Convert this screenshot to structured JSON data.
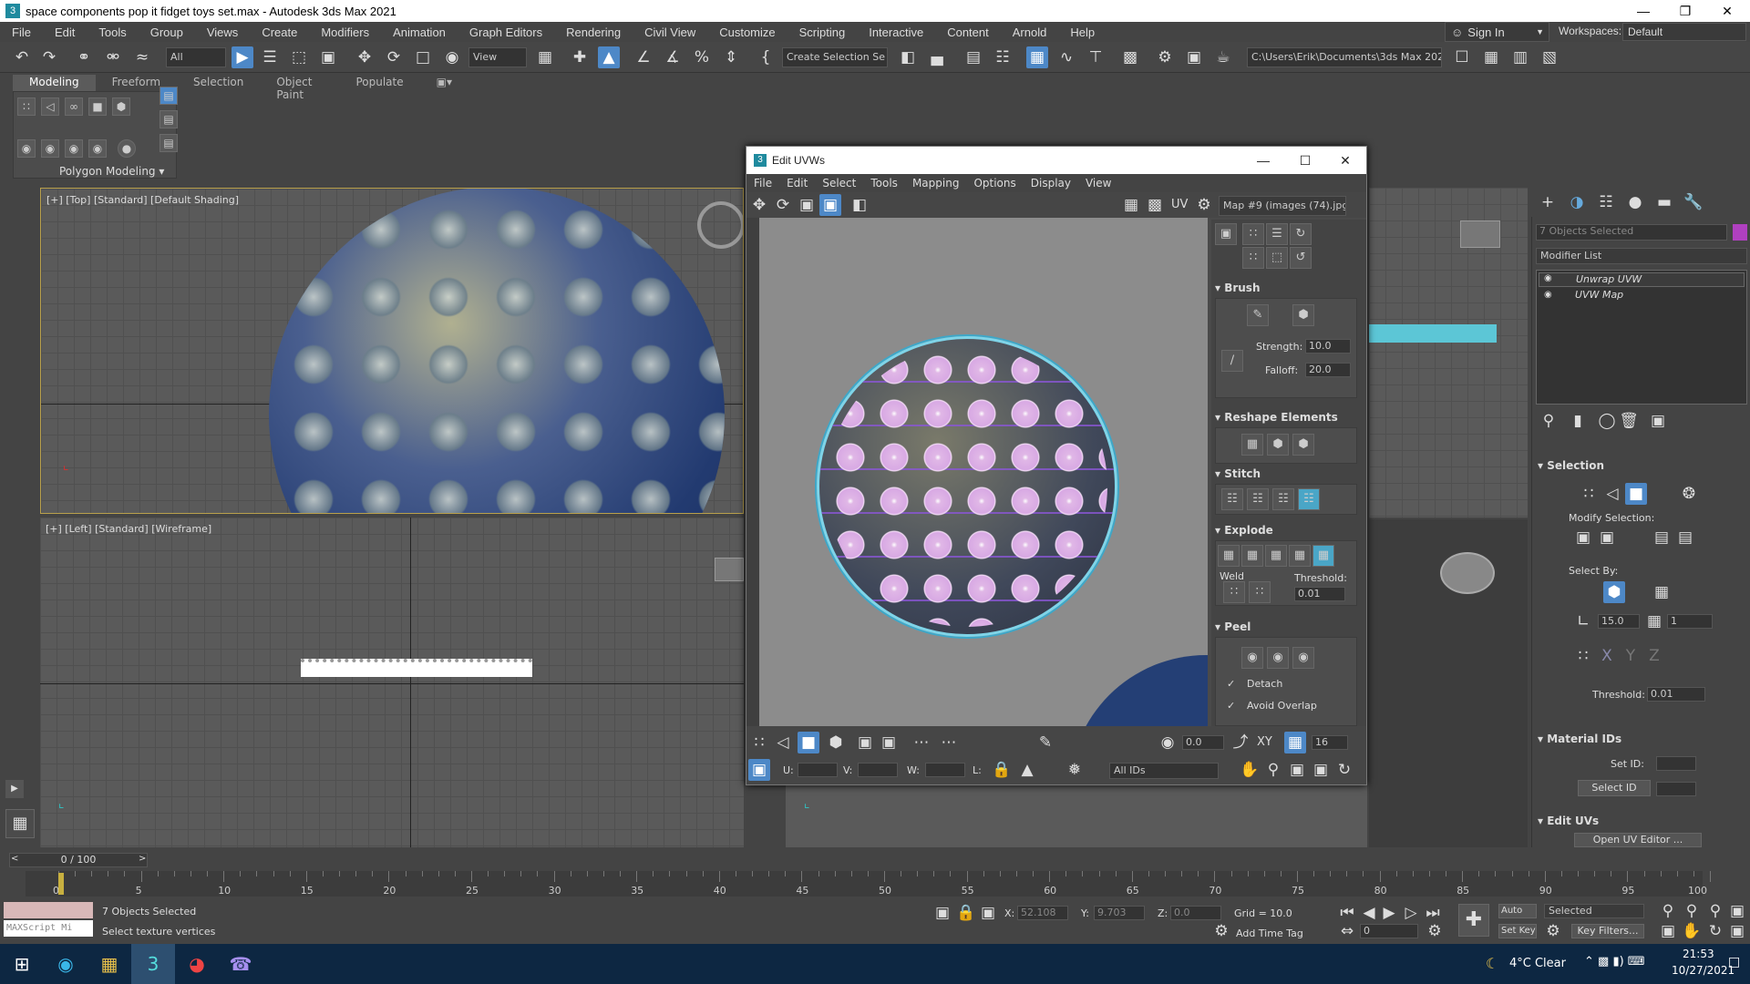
{
  "window": {
    "title": "space components pop it fidget toys set.max - Autodesk 3ds Max 2021"
  },
  "menu": [
    "File",
    "Edit",
    "Tools",
    "Group",
    "Views",
    "Create",
    "Modifiers",
    "Animation",
    "Graph Editors",
    "Rendering",
    "Civil View",
    "Customize",
    "Scripting",
    "Interactive",
    "Content",
    "Arnold",
    "Help"
  ],
  "account": {
    "sign_in": "Sign In",
    "workspaces_label": "Workspaces:",
    "workspace": "Default"
  },
  "toolbar": {
    "filter": "All",
    "view": "View",
    "selection_set": "Create Selection Se",
    "project_path": "C:\\Users\\Erik\\Documents\\3ds Max 2021"
  },
  "ribbon": {
    "tabs": [
      "Modeling",
      "Freeform",
      "Selection",
      "Object Paint",
      "Populate"
    ],
    "panel_label": "Polygon Modeling"
  },
  "viewports": {
    "top_label": "[+] [Top] [Standard] [Default Shading]",
    "left_label": "[+] [Left] [Standard] [Wireframe]"
  },
  "uv_editor": {
    "title": "Edit UVWs",
    "menu": [
      "File",
      "Edit",
      "Select",
      "Tools",
      "Mapping",
      "Options",
      "Display",
      "View"
    ],
    "uv_label": "UV",
    "map_select": "Map #9 (images (74).jpg)",
    "brush": {
      "header": "Brush",
      "strength_label": "Strength:",
      "strength": "10.0",
      "falloff_label": "Falloff:",
      "falloff": "20.0"
    },
    "reshape_header": "Reshape Elements",
    "stitch_header": "Stitch",
    "explode": {
      "header": "Explode",
      "weld_label": "Weld",
      "threshold_label": "Threshold:",
      "threshold": "0.01"
    },
    "peel": {
      "header": "Peel",
      "detach_label": "Detach",
      "avoid_overlap_label": "Avoid Overlap"
    },
    "bottom": {
      "angle": "0.0",
      "xy": "XY",
      "grid_count": "16",
      "u_label": "U:",
      "v_label": "V:",
      "w_label": "W:",
      "l_label": "L:",
      "ids": "All IDs"
    }
  },
  "command_panel": {
    "objects_selected": "7 Objects Selected",
    "modifier_list": "Modifier List",
    "stack": [
      "Unwrap UVW",
      "UVW Map"
    ],
    "selection": {
      "header": "Selection",
      "modify_selection": "Modify Selection:",
      "select_by": "Select By:",
      "angle": "15.0",
      "count": "1",
      "threshold_label": "Threshold:",
      "threshold": "0.01"
    },
    "material_ids": {
      "header": "Material IDs",
      "set_id_label": "Set ID:",
      "select_id": "Select ID"
    },
    "edit_uvs": {
      "header": "Edit UVs",
      "open_editor": "Open UV Editor ..."
    }
  },
  "timeline": {
    "slider": "0 / 100",
    "ticks": [
      "0",
      "5",
      "10",
      "15",
      "20",
      "25",
      "30",
      "35",
      "40",
      "45",
      "50",
      "55",
      "60",
      "65",
      "70",
      "75",
      "80",
      "85",
      "90",
      "95",
      "100"
    ]
  },
  "status": {
    "script_label": "MAXScript Mi",
    "objects_selected": "7 Objects Selected",
    "prompt": "Select texture vertices",
    "x_label": "X:",
    "x": "52.108",
    "y_label": "Y:",
    "y": "9.703",
    "z_label": "Z:",
    "z": "0.0",
    "grid": "Grid = 10.0",
    "add_time_tag": "Add Time Tag",
    "auto_key": "Auto K...",
    "key_mode": "Selected",
    "set_key": "Set Key",
    "key_filters": "Key Filters...",
    "frame": "0"
  },
  "taskbar": {
    "weather": "4°C  Clear",
    "time": "21:53",
    "date": "10/27/2021"
  }
}
